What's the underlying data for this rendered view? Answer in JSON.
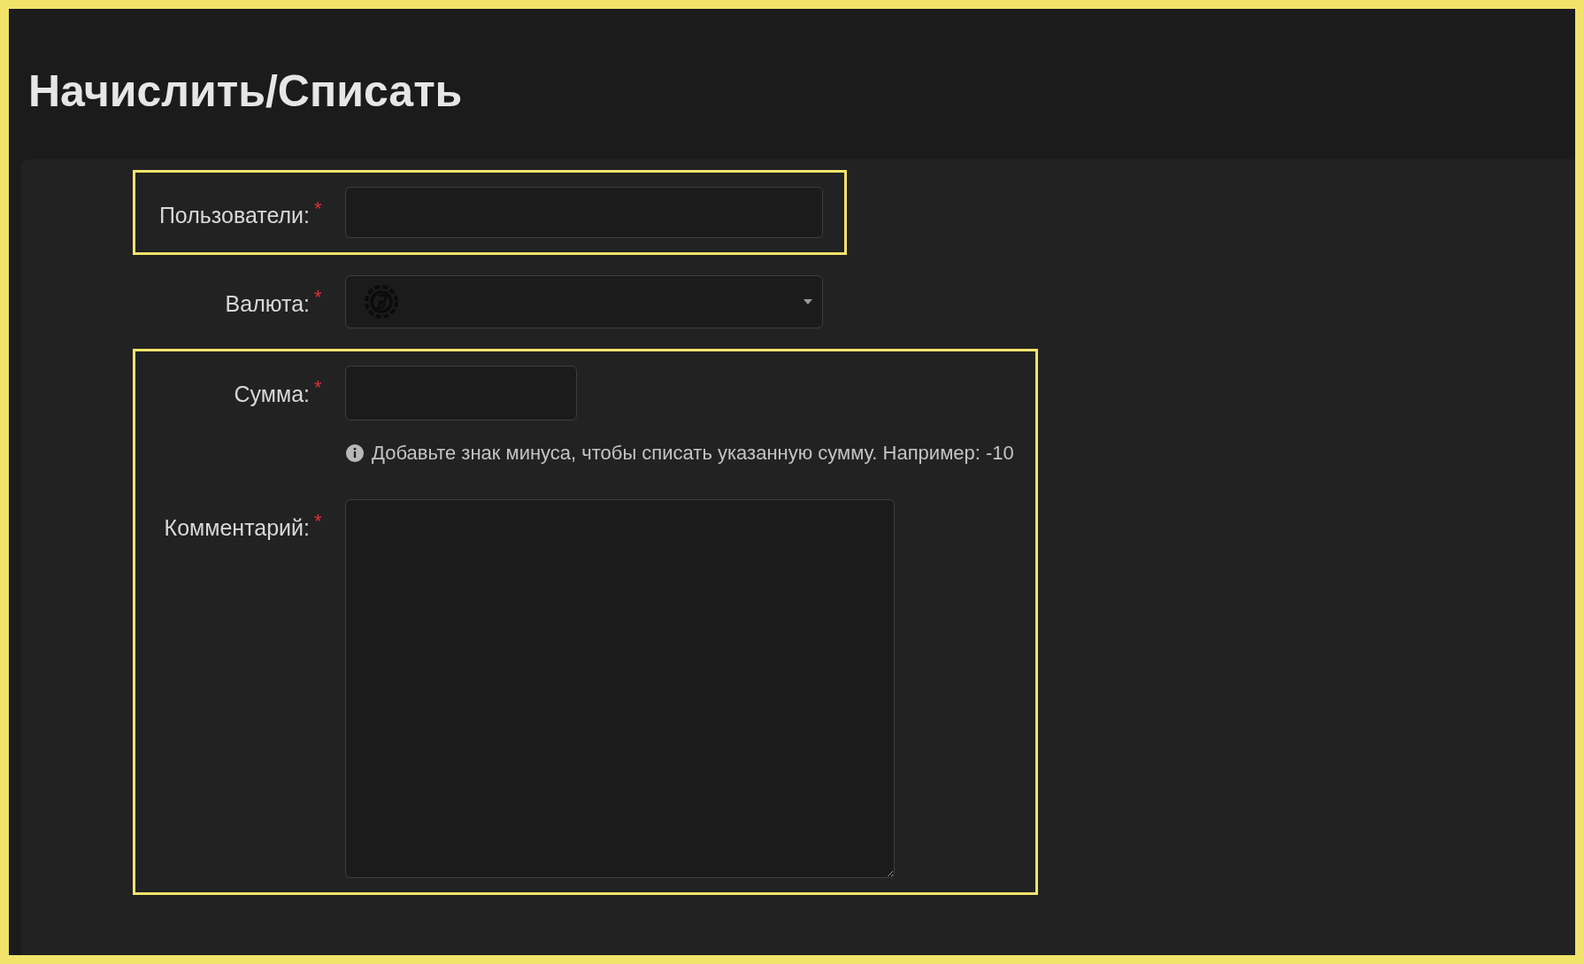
{
  "title": "Начислить/Списать",
  "groups": [
    {
      "highlighted": true,
      "fields": [
        {
          "kind": "text",
          "label": "Пользователи:",
          "required_mark": "*"
        }
      ]
    },
    {
      "highlighted": false,
      "fields": [
        {
          "kind": "select",
          "label": "Валюта:",
          "required_mark": "*"
        }
      ]
    },
    {
      "highlighted": true,
      "fields": [
        {
          "kind": "amount",
          "label": "Сумма:",
          "required_mark": "*",
          "hint": "Добавьте знак минуса, чтобы списать указанную сумму. Например: -10"
        },
        {
          "kind": "textarea",
          "label": "Комментарий:",
          "required_mark": "*"
        }
      ]
    }
  ]
}
